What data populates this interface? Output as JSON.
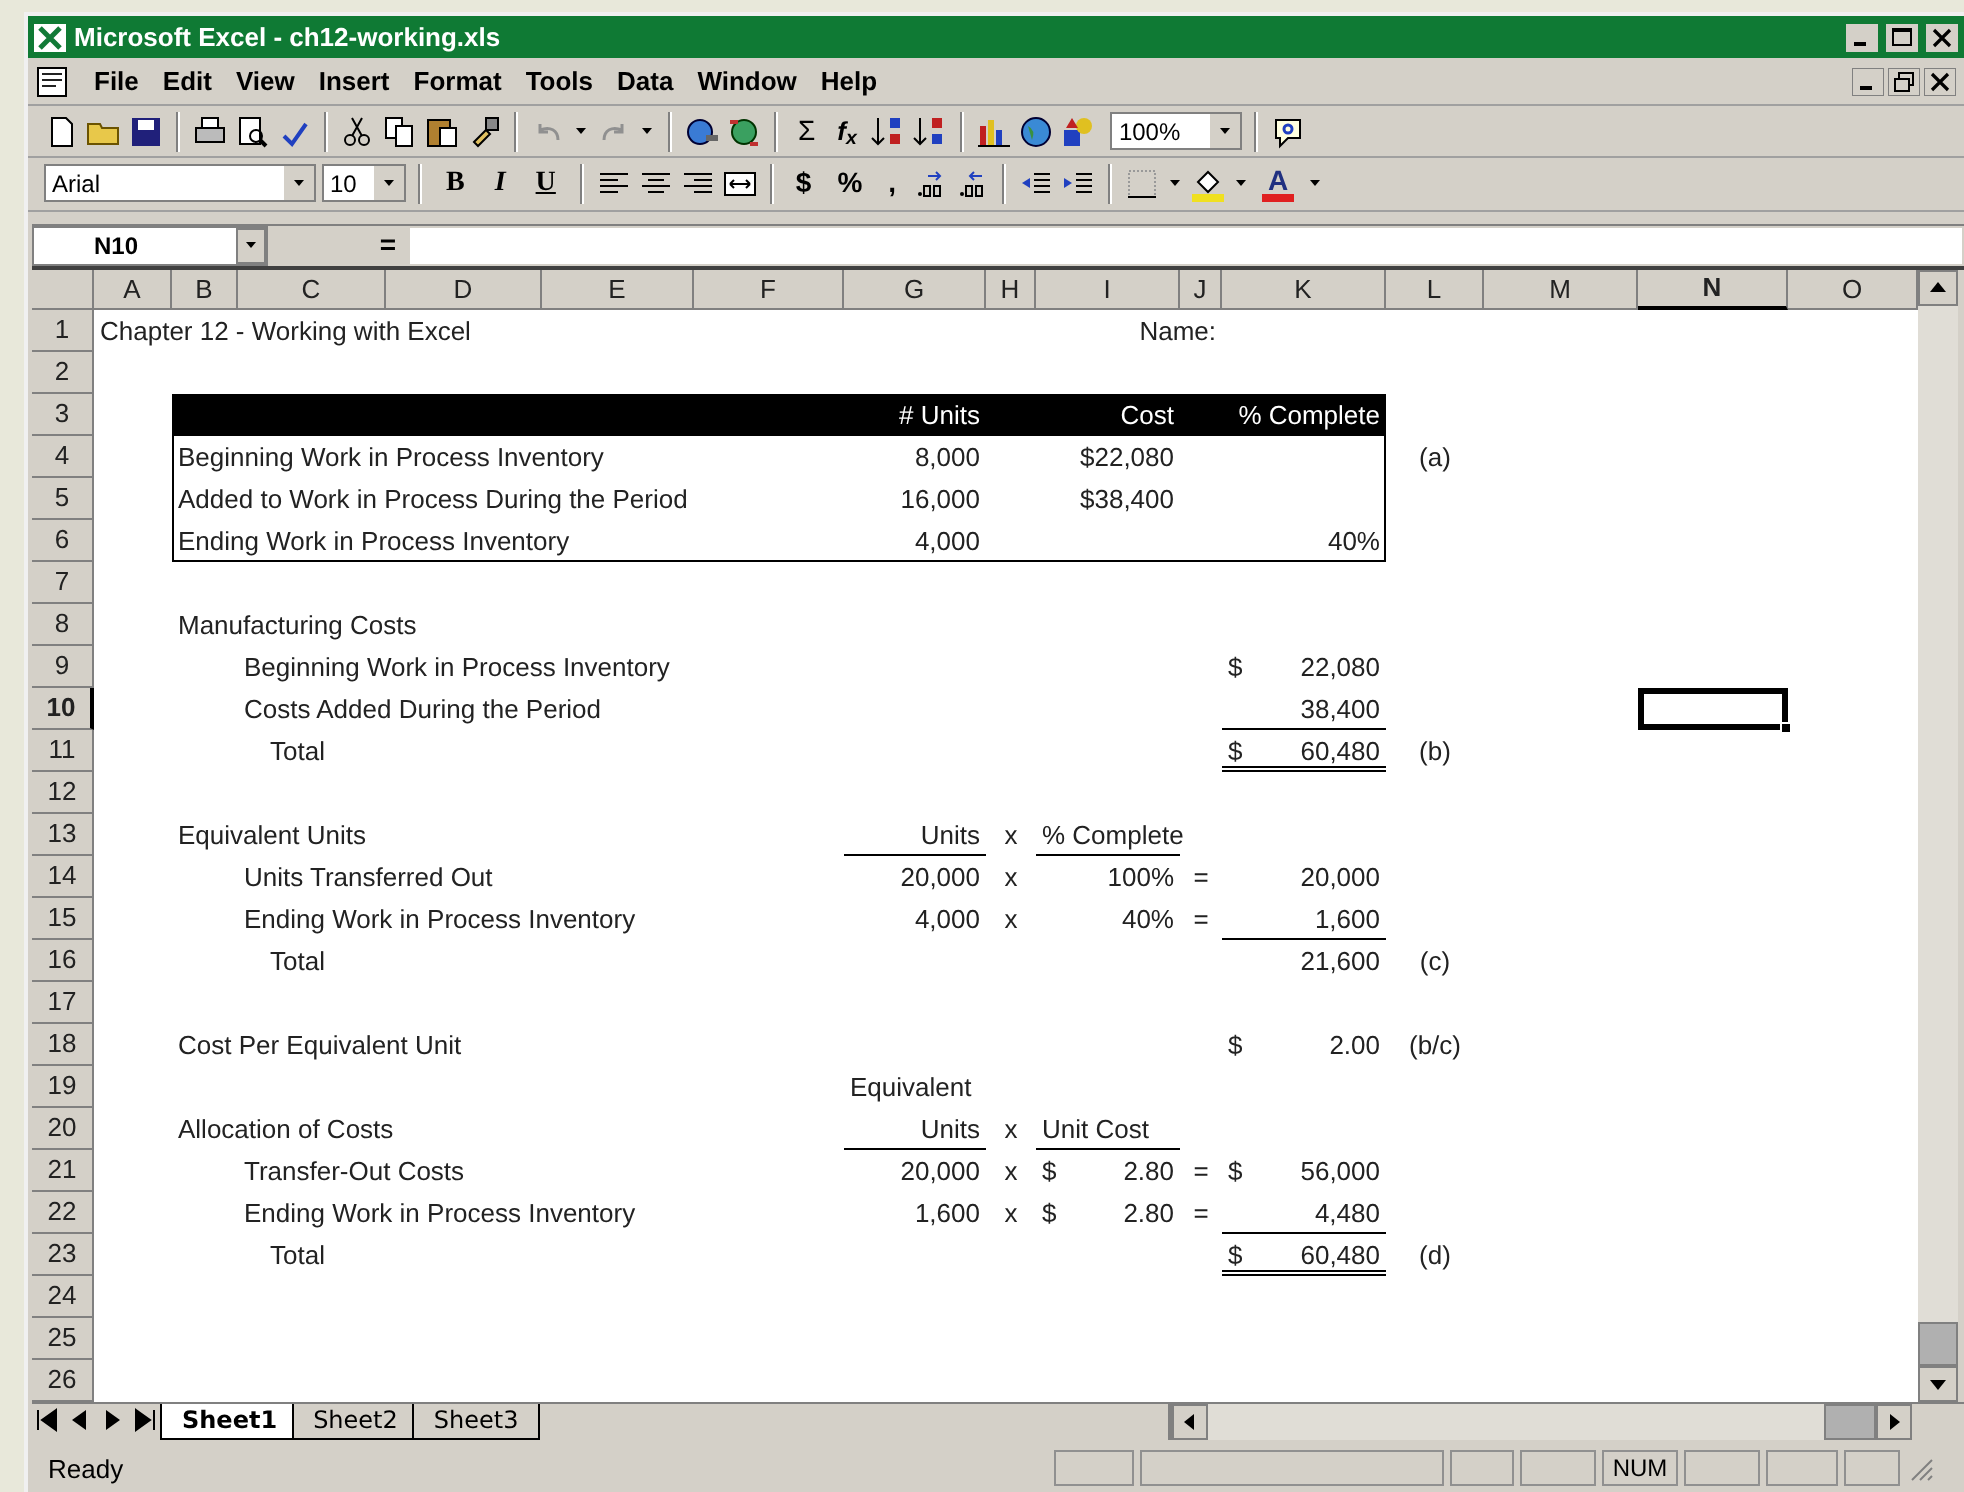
{
  "window": {
    "title": "Microsoft Excel - ch12-working.xls"
  },
  "menu": [
    "File",
    "Edit",
    "View",
    "Insert",
    "Format",
    "Tools",
    "Data",
    "Window",
    "Help"
  ],
  "toolbar_standard": {
    "autosum": "Σ",
    "function": "f$_{x}$",
    "zoom": "100%"
  },
  "toolbar_formatting": {
    "font": "Arial",
    "size": "10",
    "bold": "B",
    "italic": "I",
    "underline": "U",
    "currency": "$",
    "percent": "%",
    "comma": ",",
    "font_color": "A"
  },
  "formula_bar": {
    "name_box": "N10",
    "equals": "="
  },
  "sheet": {
    "columns": [
      {
        "label": "A",
        "selected": false
      },
      {
        "label": "B",
        "selected": false
      },
      {
        "label": "C",
        "selected": false
      },
      {
        "label": "D",
        "selected": false
      },
      {
        "label": "E",
        "selected": false
      },
      {
        "label": "F",
        "selected": false
      },
      {
        "label": "G",
        "selected": false
      },
      {
        "label": "H",
        "selected": false
      },
      {
        "label": "I",
        "selected": false
      },
      {
        "label": "J",
        "selected": false
      },
      {
        "label": "K",
        "selected": false
      },
      {
        "label": "L",
        "selected": false
      },
      {
        "label": "M",
        "selected": false
      },
      {
        "label": "N",
        "selected": true
      },
      {
        "label": "O",
        "selected": false
      }
    ],
    "rows": [
      {
        "label": "1",
        "selected": false,
        "cells": {
          "A": {
            "kind": "text",
            "text": "Chapter 12 - Working with Excel"
          },
          "J": {
            "kind": "number",
            "text": "Name:"
          }
        }
      },
      {
        "label": "2",
        "selected": false
      },
      {
        "label": "3",
        "selected": false,
        "kind": "header",
        "boxed": true,
        "cells": {
          "G": {
            "kind": "number",
            "text": "# Units"
          },
          "I": {
            "kind": "number",
            "text": "Cost"
          },
          "K": {
            "kind": "number",
            "text": "% Complete"
          }
        }
      },
      {
        "label": "4",
        "selected": false,
        "boxed": true,
        "cells": {
          "B": {
            "kind": "text",
            "text": "Beginning Work in Process Inventory"
          },
          "G": {
            "kind": "number",
            "text": "8,000"
          },
          "I": {
            "kind": "number",
            "text": "$22,080"
          },
          "L": {
            "kind": "note",
            "text": "(a)"
          }
        }
      },
      {
        "label": "5",
        "selected": false,
        "boxed": true,
        "cells": {
          "B": {
            "kind": "text",
            "text": "Added to Work in Process During the Period"
          },
          "G": {
            "kind": "number",
            "text": "16,000"
          },
          "I": {
            "kind": "number",
            "text": "$38,400"
          }
        }
      },
      {
        "label": "6",
        "selected": false,
        "boxed": true,
        "cells": {
          "B": {
            "kind": "text",
            "text": "Ending Work in Process Inventory"
          },
          "G": {
            "kind": "number",
            "text": "4,000"
          },
          "K": {
            "kind": "number",
            "text": "40%"
          }
        }
      },
      {
        "label": "7",
        "selected": false
      },
      {
        "label": "8",
        "selected": false,
        "cells": {
          "B": {
            "kind": "text",
            "text": "Manufacturing Costs"
          }
        }
      },
      {
        "label": "9",
        "selected": false,
        "cells": {
          "C": {
            "kind": "text",
            "text": "Beginning Work in Process Inventory"
          },
          "K": {
            "kind": "currency",
            "symbol": "$",
            "text": "22,080"
          }
        }
      },
      {
        "label": "10",
        "selected": true,
        "cells": {
          "C": {
            "kind": "text",
            "text": "Costs Added During the Period"
          },
          "K": {
            "kind": "number",
            "text": "38,400",
            "underlined": true
          }
        }
      },
      {
        "label": "11",
        "selected": false,
        "cells": {
          "C": {
            "kind": "text",
            "text": "Total",
            "indent": true
          },
          "K": {
            "kind": "currency",
            "symbol": "$",
            "text": "60,480",
            "double_underlined": true
          },
          "L": {
            "kind": "note",
            "text": "(b)"
          }
        }
      },
      {
        "label": "12",
        "selected": false
      },
      {
        "label": "13",
        "selected": false,
        "cells": {
          "B": {
            "kind": "text",
            "text": "Equivalent Units"
          },
          "G": {
            "kind": "number",
            "text": "Units",
            "underlined": true
          },
          "H": {
            "kind": "sign",
            "text": "x"
          },
          "I": {
            "kind": "text",
            "text": "% Complete",
            "underlined": true
          }
        }
      },
      {
        "label": "14",
        "selected": false,
        "cells": {
          "C": {
            "kind": "text",
            "text": "Units Transferred Out"
          },
          "G": {
            "kind": "number",
            "text": "20,000"
          },
          "H": {
            "kind": "sign",
            "text": "x"
          },
          "I": {
            "kind": "number",
            "text": "100%"
          },
          "J": {
            "kind": "sign",
            "text": "="
          },
          "K": {
            "kind": "number",
            "text": "20,000"
          }
        }
      },
      {
        "label": "15",
        "selected": false,
        "cells": {
          "C": {
            "kind": "text",
            "text": "Ending Work in Process Inventory"
          },
          "G": {
            "kind": "number",
            "text": "4,000"
          },
          "H": {
            "kind": "sign",
            "text": "x"
          },
          "I": {
            "kind": "number",
            "text": "40%"
          },
          "J": {
            "kind": "sign",
            "text": "="
          },
          "K": {
            "kind": "number",
            "text": "1,600",
            "underlined": true
          }
        }
      },
      {
        "label": "16",
        "selected": false,
        "cells": {
          "C": {
            "kind": "text",
            "text": "Total",
            "indent": true
          },
          "K": {
            "kind": "number",
            "text": "21,600"
          },
          "L": {
            "kind": "note",
            "text": "(c)"
          }
        }
      },
      {
        "label": "17",
        "selected": false
      },
      {
        "label": "18",
        "selected": false,
        "cells": {
          "B": {
            "kind": "text",
            "text": "Cost Per Equivalent Unit"
          },
          "K": {
            "kind": "currency",
            "symbol": "$",
            "text": "2.00"
          },
          "L": {
            "kind": "note",
            "text": "(b/c)"
          }
        }
      },
      {
        "label": "19",
        "selected": false,
        "cells": {
          "G": {
            "kind": "text",
            "text": "Equivalent"
          }
        }
      },
      {
        "label": "20",
        "selected": false,
        "cells": {
          "B": {
            "kind": "text",
            "text": "Allocation of Costs"
          },
          "G": {
            "kind": "number",
            "text": "Units",
            "underlined": true
          },
          "H": {
            "kind": "sign",
            "text": "x"
          },
          "I": {
            "kind": "text",
            "text": "Unit Cost",
            "underlined": true
          }
        }
      },
      {
        "label": "21",
        "selected": false,
        "cells": {
          "C": {
            "kind": "text",
            "text": "Transfer-Out Costs"
          },
          "G": {
            "kind": "number",
            "text": "20,000"
          },
          "H": {
            "kind": "sign",
            "text": "x"
          },
          "I": {
            "kind": "currency",
            "symbol": "$",
            "text": "2.80"
          },
          "J": {
            "kind": "sign",
            "text": "="
          },
          "K": {
            "kind": "currency",
            "symbol": "$",
            "text": "56,000"
          }
        }
      },
      {
        "label": "22",
        "selected": false,
        "cells": {
          "C": {
            "kind": "text",
            "text": "Ending Work in Process Inventory"
          },
          "G": {
            "kind": "number",
            "text": "1,600"
          },
          "H": {
            "kind": "sign",
            "text": "x"
          },
          "I": {
            "kind": "currency",
            "symbol": "$",
            "text": "2.80"
          },
          "J": {
            "kind": "sign",
            "text": "="
          },
          "K": {
            "kind": "number",
            "text": "4,480",
            "underlined": true
          }
        }
      },
      {
        "label": "23",
        "selected": false,
        "cells": {
          "C": {
            "kind": "text",
            "text": "Total",
            "indent": true
          },
          "K": {
            "kind": "currency",
            "symbol": "$",
            "text": "60,480",
            "double_underlined": true
          },
          "L": {
            "kind": "note",
            "text": "(d)"
          }
        }
      },
      {
        "label": "24",
        "selected": false
      },
      {
        "label": "25",
        "selected": false
      },
      {
        "label": "26",
        "selected": false
      }
    ]
  },
  "sheet_tabs": [
    {
      "label": "Sheet1",
      "selected": true
    },
    {
      "label": "Sheet2",
      "selected": false
    },
    {
      "label": "Sheet3",
      "selected": false
    }
  ],
  "status_bar": {
    "mode": "Ready",
    "num": "NUM"
  }
}
